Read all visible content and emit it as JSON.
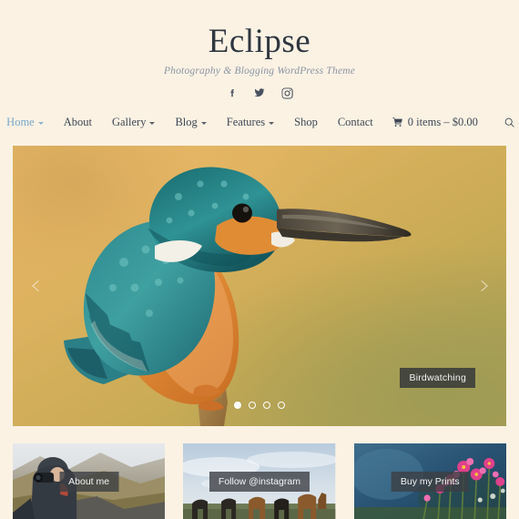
{
  "site": {
    "title": "Eclipse",
    "tagline": "Photography & Blogging WordPress Theme"
  },
  "social": [
    {
      "name": "facebook-icon",
      "label": "Facebook"
    },
    {
      "name": "twitter-icon",
      "label": "Twitter"
    },
    {
      "name": "instagram-icon",
      "label": "Instagram"
    }
  ],
  "nav": {
    "items": [
      {
        "label": "Home",
        "has_dropdown": true,
        "active": true
      },
      {
        "label": "About",
        "has_dropdown": false,
        "active": false
      },
      {
        "label": "Gallery",
        "has_dropdown": true,
        "active": false
      },
      {
        "label": "Blog",
        "has_dropdown": true,
        "active": false
      },
      {
        "label": "Features",
        "has_dropdown": true,
        "active": false
      },
      {
        "label": "Shop",
        "has_dropdown": false,
        "active": false
      },
      {
        "label": "Contact",
        "has_dropdown": false,
        "active": false
      }
    ],
    "cart": {
      "icon": "cart-icon",
      "label": "0 items – $0.00",
      "count": 0,
      "total": "$0.00"
    },
    "search": {
      "icon": "search-icon"
    }
  },
  "hero": {
    "image_alt": "Common kingfisher perched on a branch",
    "caption": "Birdwatching",
    "prev_label": "Previous slide",
    "next_label": "Next slide",
    "slides": 4,
    "active_slide": 1
  },
  "cards": [
    {
      "label": "About me",
      "image_alt": "Photographer in rain jacket with camera in mountain landscape"
    },
    {
      "label": "Follow @instagram",
      "image_alt": "Horses grazing in a field under a cloudy sky"
    },
    {
      "label": "Buy my Prints",
      "image_alt": "Pink wildflowers against a dark blue background"
    }
  ],
  "colors": {
    "page_background": "#fbf2e4",
    "title": "#2f3640",
    "tagline": "#8b93a3",
    "nav_text": "#3f4754",
    "nav_active": "#7aa8cc",
    "badge_background": "#3c3f44",
    "badge_text": "#f4f4f4"
  }
}
